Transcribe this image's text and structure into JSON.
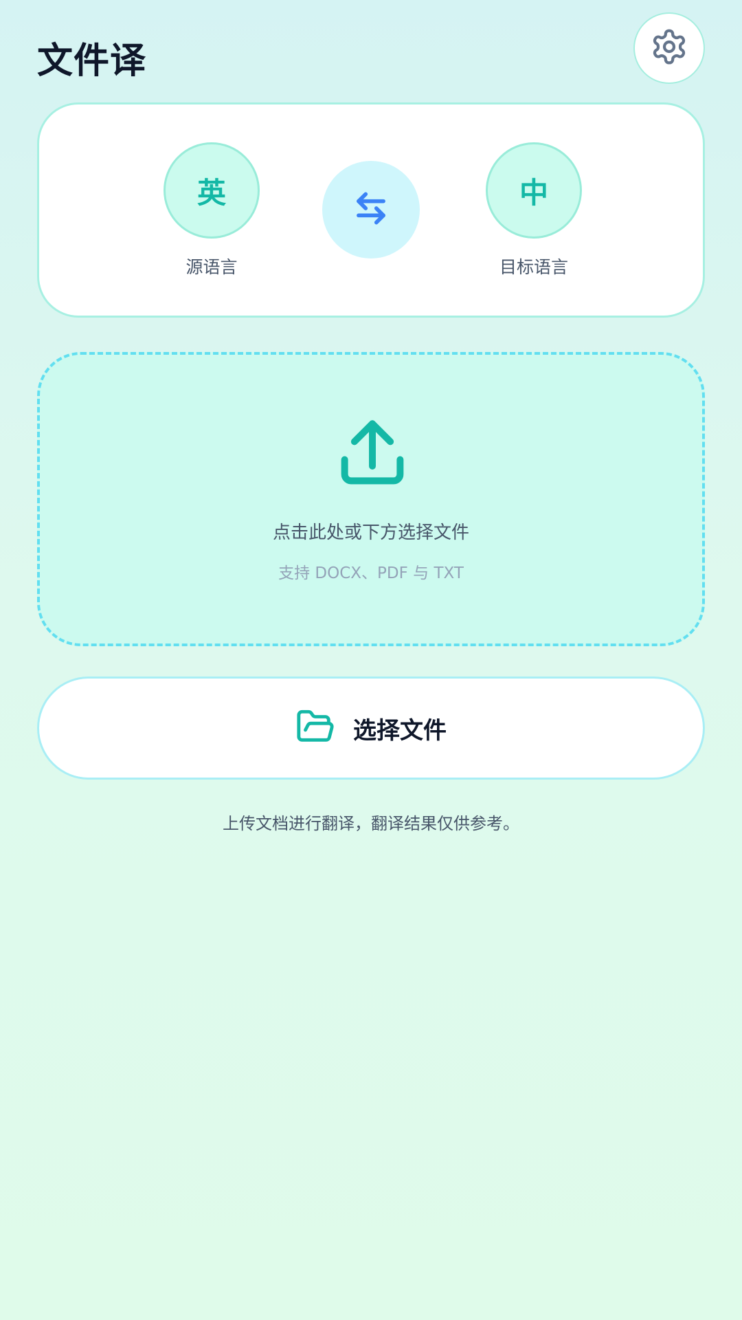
{
  "header": {
    "title": "文件译",
    "settings_icon": "gear-icon"
  },
  "languages": {
    "source": {
      "code": "英",
      "label": "源语言"
    },
    "target": {
      "code": "中",
      "label": "目标语言"
    },
    "swap_icon": "swap-arrows-icon"
  },
  "drop_zone": {
    "icon": "upload-icon",
    "title": "点击此处或下方选择文件",
    "subtitle": "支持 DOCX、PDF 与 TXT"
  },
  "choose_button": {
    "icon": "folder-open-icon",
    "label": "选择文件"
  },
  "footer": {
    "note": "上传文档进行翻译，翻译结果仅供参考。"
  },
  "colors": {
    "accent_teal": "#14b8a6",
    "swap_blue": "#3b82f6",
    "dashed_border": "#62dff0",
    "text_dark": "#0f172a",
    "text_muted": "#475569"
  }
}
